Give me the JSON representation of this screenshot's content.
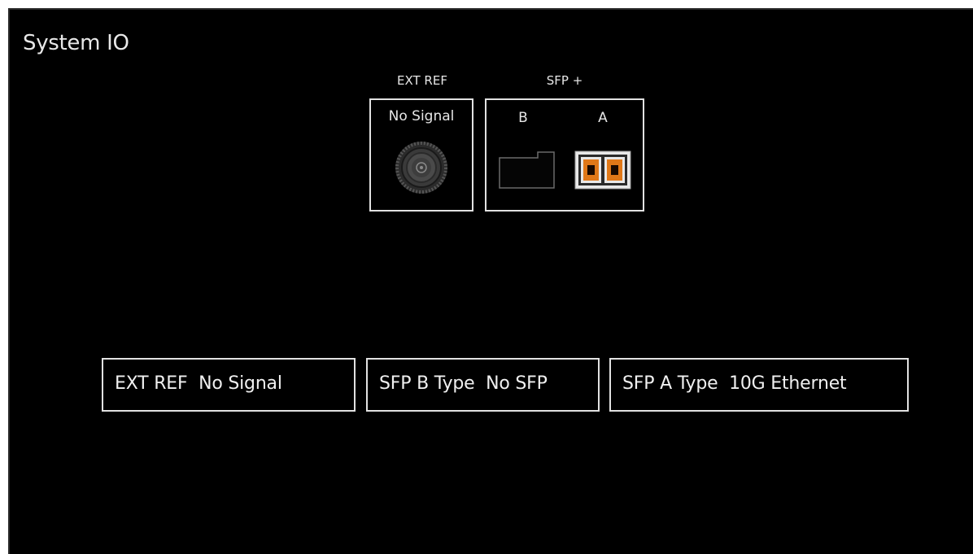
{
  "window": {
    "title": "System IO"
  },
  "diagram": {
    "ext_ref_header": "EXT REF",
    "sfp_header": "SFP +",
    "ext_ref_status": "No Signal",
    "sfp_b_label": "B",
    "sfp_a_label": "A",
    "icons": {
      "ext_ref": "bnc-connector-icon",
      "sfp_b": "empty-sfp-port-icon",
      "sfp_a": "sfp-module-icon"
    },
    "colors": {
      "sfp_active": "#e07818",
      "border": "#e2e2e2",
      "background": "#000000"
    }
  },
  "status": {
    "ext_ref": {
      "label": "EXT REF",
      "value": "No Signal"
    },
    "sfp_b": {
      "label": "SFP B Type",
      "value": "No SFP"
    },
    "sfp_a": {
      "label": "SFP A Type",
      "value": "10G Ethernet"
    }
  }
}
